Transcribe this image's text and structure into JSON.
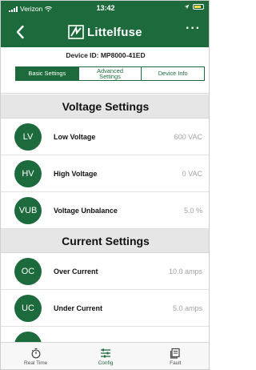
{
  "status_bar": {
    "carrier": "Verizon",
    "time": "13:42"
  },
  "header": {
    "brand": "Littelfuse",
    "more": "···",
    "icons": {
      "back": "chevron-left-icon",
      "more": "more-dots-icon",
      "logo": "littelfuse-logo"
    }
  },
  "device": {
    "id_text": "Device ID: MP8000-41ED",
    "tabs": [
      {
        "line1": "Basic Settings",
        "line2": ""
      },
      {
        "line1": "Advanced",
        "line2": "Settings"
      },
      {
        "line1": "Device Info",
        "line2": ""
      }
    ],
    "active_tab": "Basic Settings"
  },
  "sections": {
    "voltage": {
      "title": "Voltage Settings",
      "rows": [
        {
          "badge": "LV",
          "label": "Low Voltage",
          "value": "600 VAC"
        },
        {
          "badge": "HV",
          "label": "High Voltage",
          "value": "0 VAC"
        },
        {
          "badge": "VUB",
          "label": "Voltage Unbalance",
          "value": "5.0 %"
        }
      ]
    },
    "current": {
      "title": "Current Settings",
      "rows": [
        {
          "badge": "OC",
          "label": "Over Current",
          "value": "10.0 amps"
        },
        {
          "badge": "UC",
          "label": "Under Current",
          "value": "5.0 amps"
        }
      ]
    }
  },
  "bottom_nav": {
    "items": [
      {
        "label": "Real Time",
        "icon": "timer-icon"
      },
      {
        "label": "Config",
        "icon": "sliders-icon"
      },
      {
        "label": "Fault",
        "icon": "fault-log-icon"
      }
    ],
    "active": "Config"
  },
  "colors": {
    "brand_green": "#1d6a3c",
    "section_bg": "#e6e6e6",
    "value_gray": "#a2a2a2"
  }
}
